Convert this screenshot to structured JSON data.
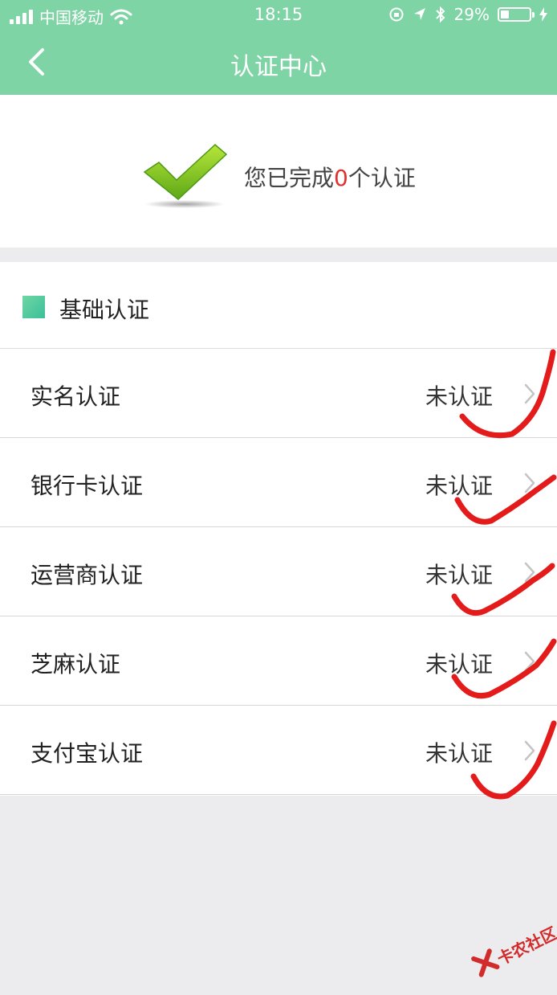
{
  "status_bar": {
    "carrier": "中国移动",
    "time": "18:15",
    "battery": "29%",
    "battery_level": 0.29
  },
  "nav": {
    "title": "认证中心",
    "back_icon": "chevron-left-icon"
  },
  "summary": {
    "prefix": "您已完成",
    "count": "0",
    "suffix": "个认证",
    "icon": "checkmark-icon"
  },
  "section": {
    "title": "基础认证"
  },
  "items": [
    {
      "label": "实名认证",
      "status": "未认证"
    },
    {
      "label": "银行卡认证",
      "status": "未认证"
    },
    {
      "label": "运营商认证",
      "status": "未认证"
    },
    {
      "label": "芝麻认证",
      "status": "未认证"
    },
    {
      "label": "支付宝认证",
      "status": "未认证"
    }
  ],
  "watermark": {
    "text": "卡农社区"
  },
  "colors": {
    "header_green": "#7fd4a6",
    "accent_red": "#e2302f",
    "annotation_red": "#e31b1b"
  }
}
